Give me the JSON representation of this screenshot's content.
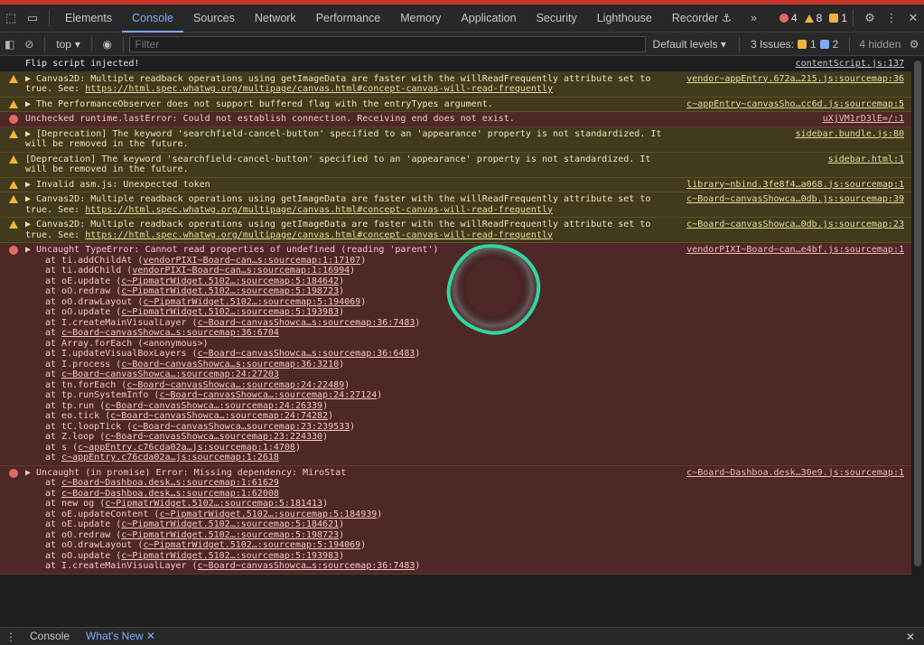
{
  "tabs": {
    "items": [
      "Elements",
      "Console",
      "Sources",
      "Network",
      "Performance",
      "Memory",
      "Application",
      "Security",
      "Lighthouse",
      "Recorder ⚓"
    ],
    "more": "»",
    "errors": "4",
    "warnings": "8",
    "issues": "1"
  },
  "toolbar": {
    "context": "top",
    "filter_placeholder": "Filter",
    "levels": "Default levels ▾",
    "issues_label": "3 Issues:",
    "issues_warn": "1",
    "issues_info": "2",
    "hidden": "4 hidden"
  },
  "messages": [
    {
      "type": "log",
      "text": "Flip script injected!",
      "source": "contentScript.js:137"
    },
    {
      "type": "warn",
      "text": "▶ Canvas2D: Multiple readback operations using getImageData are faster with the willReadFrequently attribute set to true. See: ",
      "url": "https://html.spec.whatwg.org/multipage/canvas.html#concept-canvas-will-read-frequently",
      "source": "vendor~appEntry.672a…215.js:sourcemap:36"
    },
    {
      "type": "warn",
      "text": "▶ The PerformanceObserver does not support buffered flag with the entryTypes argument.",
      "source": "c~appEntry~canvasSho…cc6d.js:sourcemap:5"
    },
    {
      "type": "error",
      "text": "Unchecked runtime.lastError: Could not establish connection. Receiving end does not exist.",
      "source": "uXjVM1rD3lE=/:1"
    },
    {
      "type": "warn",
      "text": "▶ [Deprecation] The keyword 'searchfield-cancel-button' specified to an 'appearance' property is not standardized. It will be removed in the future.",
      "source": "sidebar.bundle.js:80"
    },
    {
      "type": "warn",
      "text": "[Deprecation] The keyword 'searchfield-cancel-button' specified to an 'appearance' property is not standardized. It will be removed in the future.",
      "source": "sidebar.html:1"
    },
    {
      "type": "warn",
      "text": "▶ Invalid asm.js: Unexpected token",
      "source": "library~nbind.3fe8f4…a068.js:sourcemap:1"
    },
    {
      "type": "warn",
      "text": "▶ Canvas2D: Multiple readback operations using getImageData are faster with the willReadFrequently attribute set to true. See: ",
      "url": "https://html.spec.whatwg.org/multipage/canvas.html#concept-canvas-will-read-frequently",
      "source": "c~Board~canvasShowca…0db.js:sourcemap:39"
    },
    {
      "type": "warn",
      "text": "▶ Canvas2D: Multiple readback operations using getImageData are faster with the willReadFrequently attribute set to true. See: ",
      "url": "https://html.spec.whatwg.org/multipage/canvas.html#concept-canvas-will-read-frequently",
      "source": "c~Board~canvasShowca…0db.js:sourcemap:23"
    },
    {
      "type": "error",
      "text": "▶ Uncaught TypeError: Cannot read properties of undefined (reading 'parent')",
      "source": "vendorPIXI~Board~can…e4bf.js:sourcemap:1",
      "frames": [
        [
          "at ti.addChildAt (",
          "vendorPIXI~Board~can…s:sourcemap:1:17107",
          ")"
        ],
        [
          "at ti.addChild (",
          "vendorPIXI~Board~can…s:sourcemap:1:16994",
          ")"
        ],
        [
          "at oE.update (",
          "c~PipmatrWidget.5102…:sourcemap:5:184642",
          ")"
        ],
        [
          "at oO.redraw (",
          "c~PipmatrWidget.5102…:sourcemap:5:198723",
          ")"
        ],
        [
          "at oO.drawLayout (",
          "c~PipmatrWidget.5102…:sourcemap:5:194069",
          ")"
        ],
        [
          "at oO.update (",
          "c~PipmatrWidget.5102…:sourcemap:5:193983",
          ")"
        ],
        [
          "at I.createMainVisualLayer (",
          "c~Board~canvasShowca…s:sourcemap:36:7483",
          ")"
        ],
        [
          "at ",
          "c~Board~canvasShowca…s:sourcemap:36:6704",
          ""
        ],
        [
          "at Array.forEach (<anonymous>)",
          "",
          ""
        ],
        [
          "at I.updateVisualBoxLayers (",
          "c~Board~canvasShowca…s:sourcemap:36:6483",
          ")"
        ],
        [
          "at I.process (",
          "c~Board~canvasShowca…s:sourcemap:36:3210",
          ")"
        ],
        [
          "at ",
          "c~Board~canvasShowca…:sourcemap:24:27203",
          ""
        ],
        [
          "at tn.forEach (",
          "c~Board~canvasShowca…:sourcemap:24:22489",
          ")"
        ],
        [
          "at tp.runSystemInfo (",
          "c~Board~canvasShowca…:sourcemap:24:27124",
          ")"
        ],
        [
          "at tp.run (",
          "c~Board~canvasShowca…:sourcemap:24:26339",
          ")"
        ],
        [
          "at eo.tick (",
          "c~Board~canvasShowca…:sourcemap:24:74282",
          ")"
        ],
        [
          "at tC.loopTick (",
          "c~Board~canvasShowca…sourcemap:23:239533",
          ")"
        ],
        [
          "at Z.loop (",
          "c~Board~canvasShowca…sourcemap:23:224330",
          ")"
        ],
        [
          "at s (",
          "c~appEntry.c76cda02a…js:sourcemap:1:4708",
          ")"
        ],
        [
          "at ",
          "c~appEntry.c76cda02a…js:sourcemap:1:2618",
          ""
        ]
      ]
    },
    {
      "type": "error",
      "text": "▶ Uncaught (in promise) Error: Missing dependency: MiroStat",
      "source": "c~Board~Dashboa.desk…30e9.js:sourcemap:1",
      "frames": [
        [
          "at ",
          "c~Board~Dashboa.desk…s:sourcemap:1:61629",
          ""
        ],
        [
          "at ",
          "c~Board~Dashboa.desk…s:sourcemap:1:62008",
          ""
        ],
        [
          "at new og (",
          "c~PipmatrWidget.5102…:sourcemap:5:181413",
          ")"
        ],
        [
          "at oE.updateContent (",
          "c~PipmatrWidget.5102…:sourcemap:5:184939",
          ")"
        ],
        [
          "at oE.update (",
          "c~PipmatrWidget.5102…:sourcemap:5:184621",
          ")"
        ],
        [
          "at oO.redraw (",
          "c~PipmatrWidget.5102…:sourcemap:5:198723",
          ")"
        ],
        [
          "at oO.drawLayout (",
          "c~PipmatrWidget.5102…:sourcemap:5:194069",
          ")"
        ],
        [
          "at oO.update (",
          "c~PipmatrWidget.5102…:sourcemap:5:193983",
          ")"
        ],
        [
          "at I.createMainVisualLayer (",
          "c~Board~canvasShowca…s:sourcemap:36:7483",
          ")"
        ]
      ]
    }
  ],
  "drawer": {
    "tabs": [
      "Console",
      "What's New ✕"
    ]
  },
  "icons": {
    "inspect": "inspect-icon",
    "device": "device-toggle-icon",
    "settings": "gear-icon",
    "menu": "kebab-menu-icon",
    "close": "close-icon",
    "sidebar": "sidebar-icon",
    "clear": "clear-console-icon",
    "eye": "live-expression-icon"
  },
  "colors": {
    "accent": "#7cacf8",
    "error": "#e46962",
    "warning": "#f2b33d",
    "loader": "#2fd6a0"
  }
}
